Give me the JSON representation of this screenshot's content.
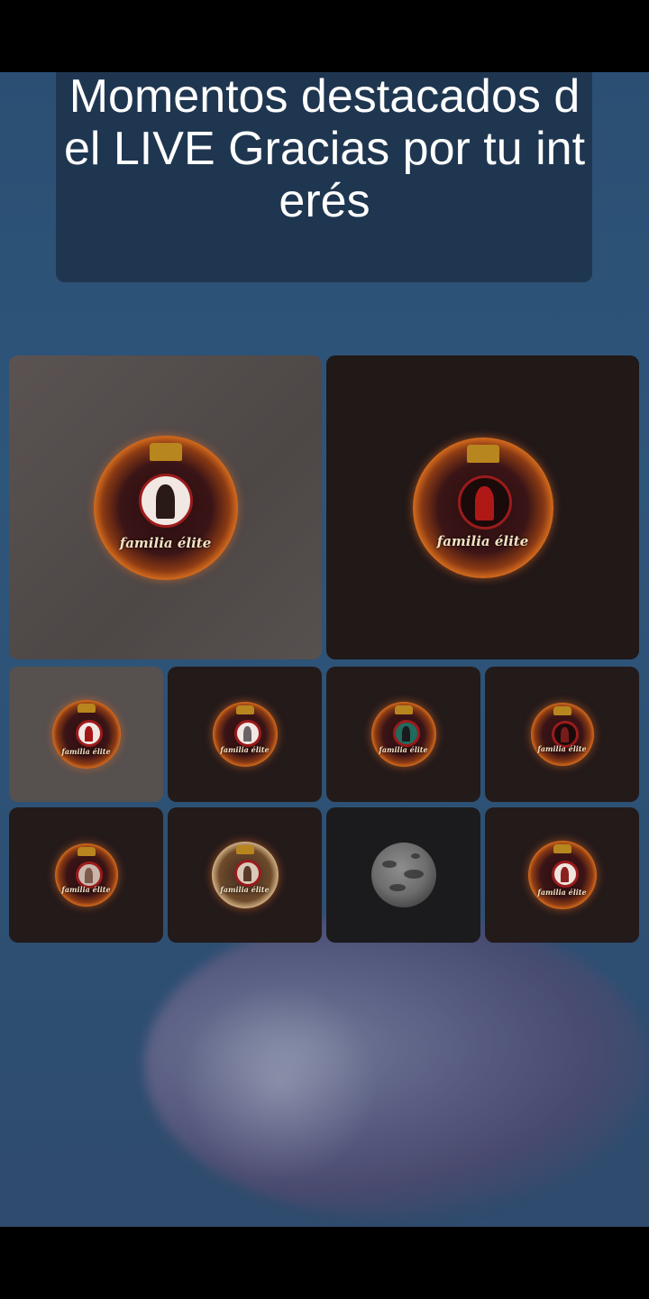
{
  "header": {
    "title": "Momentos destacados del LIVE Gracias por tu interés"
  },
  "grid": {
    "tiles": [
      {
        "badge_text": "familia élite",
        "variant": "big-light"
      },
      {
        "badge_text": "familia élite",
        "variant": "big-dark"
      },
      {
        "badge_text": "familia élite",
        "variant": "light"
      },
      {
        "badge_text": "familia élite",
        "variant": "dark"
      },
      {
        "badge_text": "familia élite",
        "variant": "dark"
      },
      {
        "badge_text": "familia élite",
        "variant": "dark"
      },
      {
        "badge_text": "familia élite",
        "variant": "dark"
      },
      {
        "badge_text": "familia élite",
        "variant": "dark"
      },
      {
        "badge_text": "",
        "variant": "black"
      },
      {
        "badge_text": "familia élite",
        "variant": "dark"
      }
    ]
  },
  "colors": {
    "background": "#2b4f73",
    "title_box": "#1f3650",
    "badge_fire": "#e0731e",
    "badge_purple": "#7b35c9"
  }
}
